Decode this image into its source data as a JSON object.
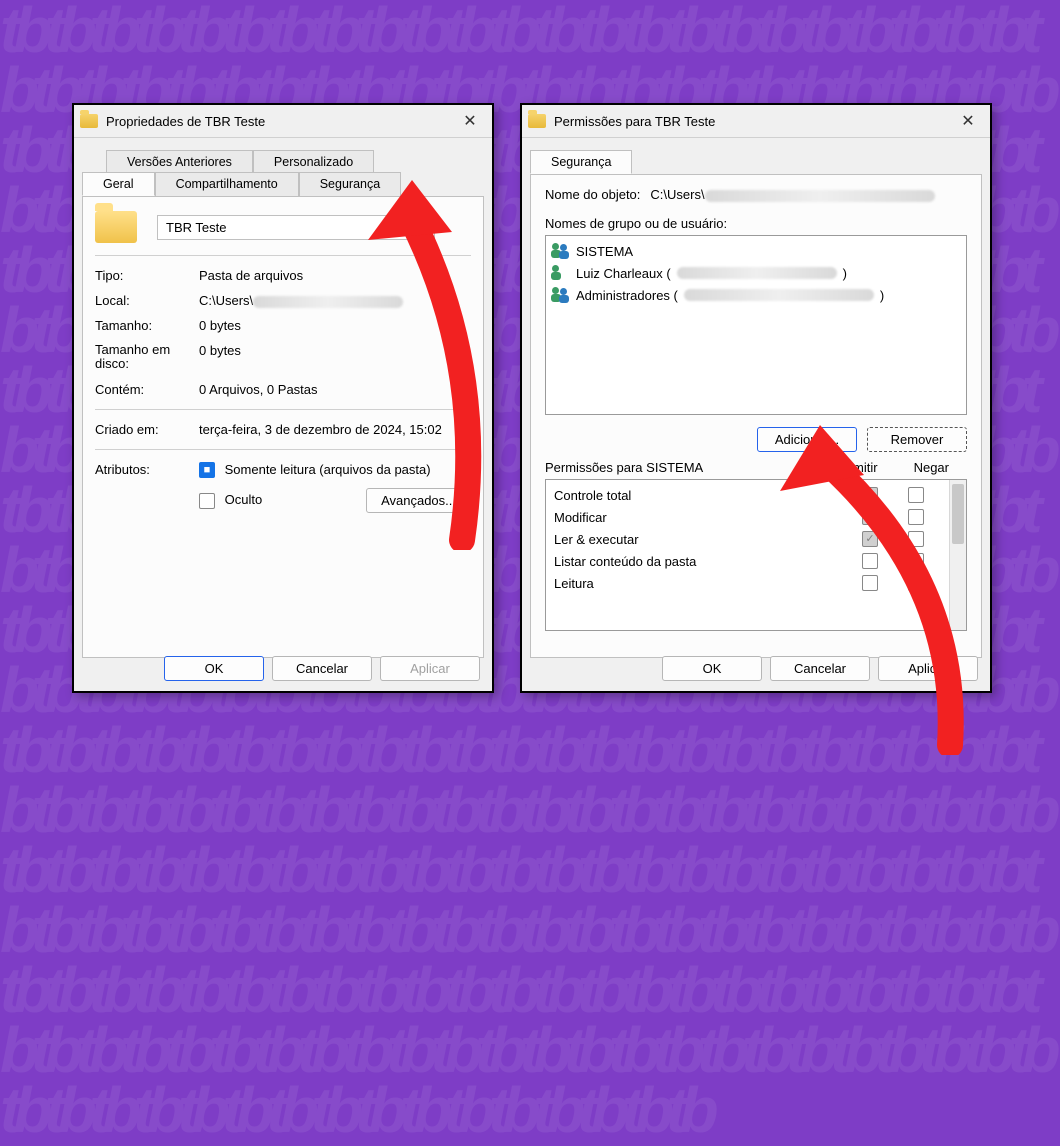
{
  "colors": {
    "accent": "#1473e6",
    "arrow": "#f22121"
  },
  "dialog_left": {
    "title": "Propriedades de TBR Teste",
    "tabs_back": {
      "prev_versions": "Versões Anteriores",
      "custom": "Personalizado"
    },
    "tabs_front": {
      "general": "Geral",
      "sharing": "Compartilhamento",
      "security": "Segurança"
    },
    "folder_name": "TBR Teste",
    "labels": {
      "type": "Tipo:",
      "type_val": "Pasta de arquivos",
      "location": "Local:",
      "location_val_prefix": "C:\\Users\\",
      "size": "Tamanho:",
      "size_val": "0 bytes",
      "size_disk": "Tamanho em disco:",
      "size_disk_val": "0 bytes",
      "contains": "Contém:",
      "contains_val": "0 Arquivos, 0 Pastas",
      "created": "Criado em:",
      "created_val": "terça-feira, 3 de dezembro de 2024, 15:02",
      "attributes": "Atributos:",
      "readonly": "Somente leitura (arquivos da pasta)",
      "hidden": "Oculto",
      "advanced": "Avançados..."
    },
    "buttons": {
      "ok": "OK",
      "cancel": "Cancelar",
      "apply": "Aplicar"
    }
  },
  "dialog_right": {
    "title": "Permissões para TBR Teste",
    "tab": "Segurança",
    "object_label": "Nome do objeto:",
    "object_value_prefix": "C:\\Users\\",
    "group_label": "Nomes de grupo ou de usuário:",
    "users": [
      {
        "name": "SISTEMA",
        "suffix": "",
        "type": "group"
      },
      {
        "name": "Luiz Charleaux (",
        "suffix": ")",
        "type": "single"
      },
      {
        "name": "Administradores (",
        "suffix": ")",
        "type": "group"
      }
    ],
    "add": "Adicionar...",
    "remove": "Remover",
    "perm_header": "Permissões para SISTEMA",
    "allow": "Permitir",
    "deny": "Negar",
    "permissions": [
      {
        "label": "Controle total",
        "allow": true,
        "deny": false
      },
      {
        "label": "Modificar",
        "allow": true,
        "deny": false
      },
      {
        "label": "Ler & executar",
        "allow": true,
        "deny": false
      },
      {
        "label": "Listar conteúdo da pasta",
        "allow": false,
        "deny": false
      },
      {
        "label": "Leitura",
        "allow": false,
        "deny": false
      }
    ],
    "buttons": {
      "ok": "OK",
      "cancel": "Cancelar",
      "apply": "Aplicar"
    }
  }
}
